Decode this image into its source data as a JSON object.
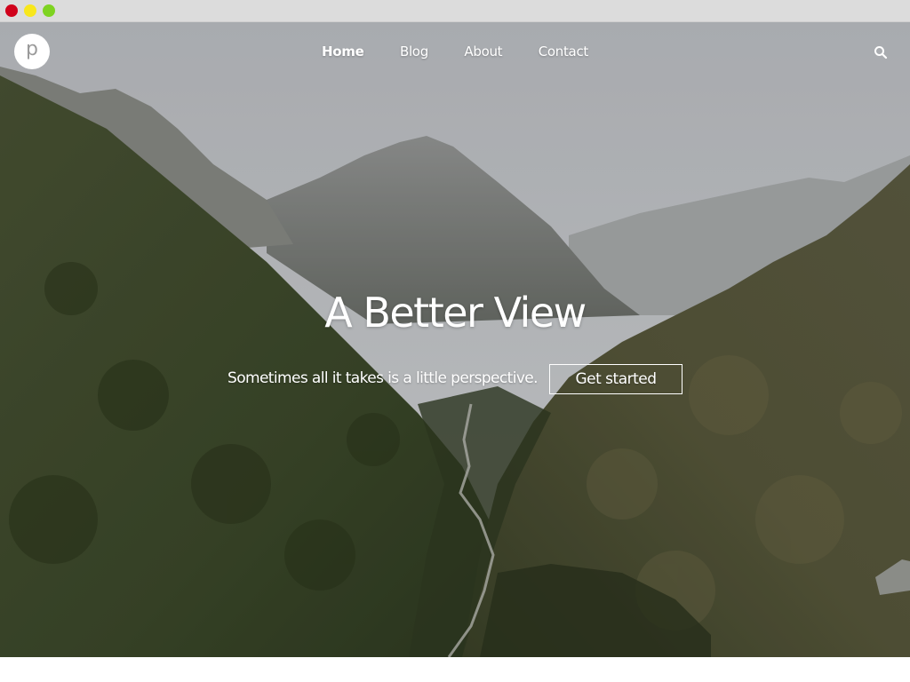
{
  "window": {
    "controls": [
      "close",
      "minimize",
      "maximize"
    ]
  },
  "header": {
    "logo_letter": "p",
    "nav": [
      {
        "label": "Home",
        "active": true
      },
      {
        "label": "Blog",
        "active": false
      },
      {
        "label": "About",
        "active": false
      },
      {
        "label": "Contact",
        "active": false
      }
    ],
    "search_icon": "search-icon"
  },
  "hero": {
    "title": "A Better View",
    "subtitle": "Sometimes all it takes is a little perspective.",
    "cta_label": "Get started",
    "background": "mountain-valley-photo"
  },
  "colors": {
    "text": "#ffffff",
    "titlebar": "#dcdcdc",
    "close": "#d0021b",
    "minimize": "#f8e71c",
    "maximize": "#7ed321"
  }
}
